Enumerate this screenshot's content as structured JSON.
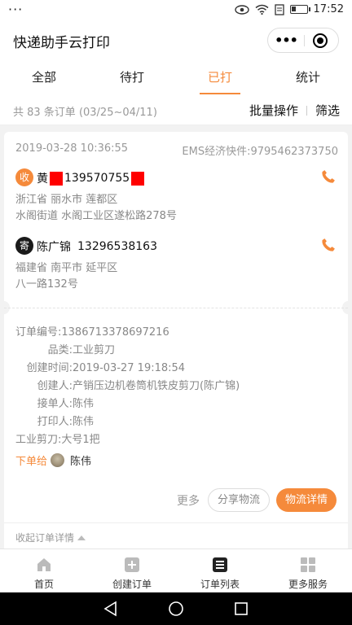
{
  "status_bar": {
    "dots": "···",
    "time": "17:52",
    "battery_level": 0.35
  },
  "header": {
    "title": "快递助手云打印",
    "capsule_more": "•••"
  },
  "tabs": [
    {
      "label": "全部"
    },
    {
      "label": "待打"
    },
    {
      "label": "已打",
      "active": true
    },
    {
      "label": "统计"
    }
  ],
  "summary": {
    "count_text": "共 83 条订单 (03/25~04/11)",
    "batch_label": "批量操作",
    "filter_label": "筛选"
  },
  "order": {
    "datetime": "2019-03-28 10:36:55",
    "tracking": "EMS经济快件:9795462373750",
    "receiver": {
      "badge": "收",
      "name_prefix": "黄",
      "phone": "139570755",
      "address_line1": "浙江省 丽水市 莲都区",
      "address_line2": "水阁街道 水阁工业区遂松路278号"
    },
    "sender": {
      "badge": "寄",
      "name": "陈广锦",
      "phone": "13296538163",
      "address_line1": "福建省 南平市 延平区",
      "address_line2": "八一路132号"
    },
    "details": {
      "order_no_label": "订单编号:",
      "order_no": "1386713378697216",
      "category_label": "品类:",
      "category": "工业剪刀",
      "created_label": "创建时间:",
      "created": "2019-03-27 19:18:54",
      "creator_label": "创建人:",
      "creator": "产销压边机卷筒机铁皮剪刀(陈广锦)",
      "receiver_label": "接单人:",
      "receiver": "陈伟",
      "printer_label": "打印人:",
      "printer": "陈伟",
      "items": "工业剪刀:大号1把"
    },
    "assign_label": "下单给",
    "assign_to": "陈伟",
    "more_label": "更多",
    "share_label": "分享物流",
    "detail_label": "物流详情",
    "collapse_label": "收起订单详情"
  },
  "colors": {
    "accent": "#f58a3b",
    "redaction": "#ff0000"
  },
  "bottom_tabs": [
    {
      "label": "首页",
      "icon": "home-icon"
    },
    {
      "label": "创建订单",
      "icon": "add-order-icon"
    },
    {
      "label": "订单列表",
      "icon": "order-list-icon",
      "active": true
    },
    {
      "label": "更多服务",
      "icon": "grid-icon"
    }
  ]
}
